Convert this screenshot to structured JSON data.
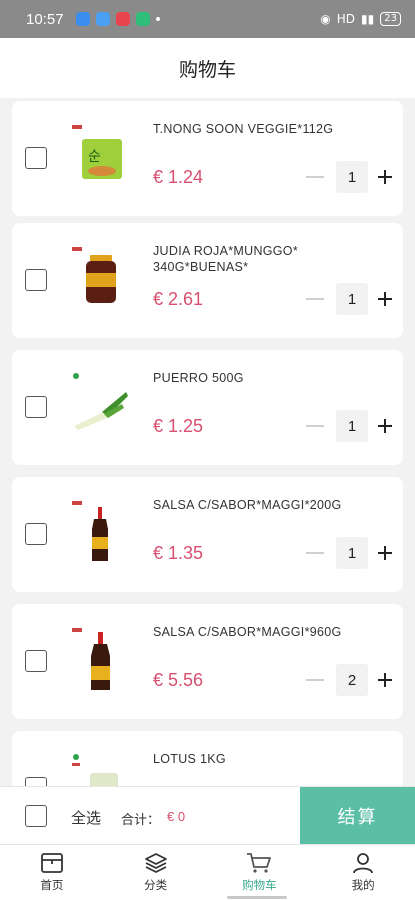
{
  "status_bar": {
    "time": "10:57",
    "network": "HD",
    "battery": "23"
  },
  "header": {
    "title": "购物车"
  },
  "cart": {
    "items": [
      {
        "name": "T.NONG SOON VEGGIE*112G",
        "price": "€ 1.24",
        "qty": "1",
        "checked": false
      },
      {
        "name": "JUDIA ROJA*MUNGGO* 340G*BUENAS*",
        "price": "€ 2.61",
        "qty": "1",
        "checked": false
      },
      {
        "name": "PUERRO 500G",
        "price": "€ 1.25",
        "qty": "1",
        "checked": false
      },
      {
        "name": "SALSA C/SABOR*MAGGI*200G",
        "price": "€ 1.35",
        "qty": "1",
        "checked": false
      },
      {
        "name": "SALSA C/SABOR*MAGGI*960G",
        "price": "€ 5.56",
        "qty": "2",
        "checked": false
      },
      {
        "name": "LOTUS 1KG",
        "price": "",
        "qty": "",
        "checked": false
      }
    ]
  },
  "checkout": {
    "select_all_label": "全选",
    "total_label": "合计：",
    "total_value": "€ 0",
    "button_label": "结算"
  },
  "tabs": [
    {
      "label": "首页",
      "icon": "store-icon",
      "active": false
    },
    {
      "label": "分类",
      "icon": "layers-icon",
      "active": false
    },
    {
      "label": "购物车",
      "icon": "cart-icon",
      "active": true
    },
    {
      "label": "我的",
      "icon": "user-icon",
      "active": false
    }
  ],
  "colors": {
    "accent": "#5bbfa6",
    "price": "#d94f6f",
    "active_tab": "#3aa98d"
  }
}
